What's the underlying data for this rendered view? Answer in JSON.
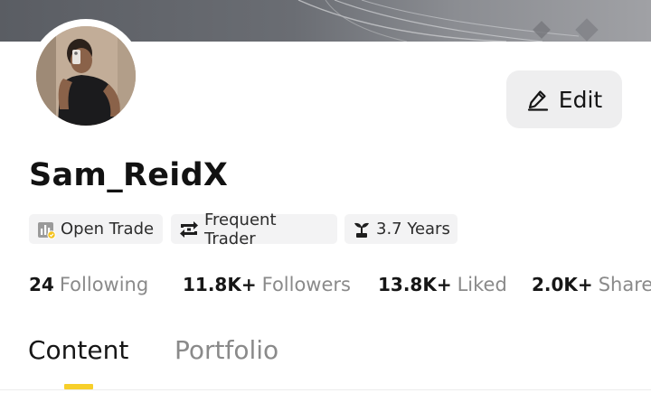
{
  "banner": {
    "icon": "cover-banner"
  },
  "profile": {
    "avatar_icon": "user-avatar-photo",
    "username": "Sam_ReidX",
    "edit": {
      "label": "Edit",
      "icon": "pencil-edit-icon"
    }
  },
  "badges": [
    {
      "label": "Open Trade",
      "icon": "open-trade-chart-icon"
    },
    {
      "label": "Frequent Trader",
      "icon": "frequent-trader-swap-icon"
    },
    {
      "label": "3.7 Years",
      "icon": "sprout-trophy-icon"
    }
  ],
  "stats": [
    {
      "value": "24",
      "label": "Following"
    },
    {
      "value": "11.8K+",
      "label": "Followers"
    },
    {
      "value": "13.8K+",
      "label": "Liked"
    },
    {
      "value": "2.0K+",
      "label": "Shared"
    }
  ],
  "tabs": [
    {
      "label": "Content",
      "active": true
    },
    {
      "label": "Portfolio",
      "active": false
    }
  ],
  "colors": {
    "accent": "#f7cf2a",
    "badge_bg": "#f3f3f4",
    "edit_bg": "#eeeeef",
    "muted_text": "#8a8a8a"
  }
}
